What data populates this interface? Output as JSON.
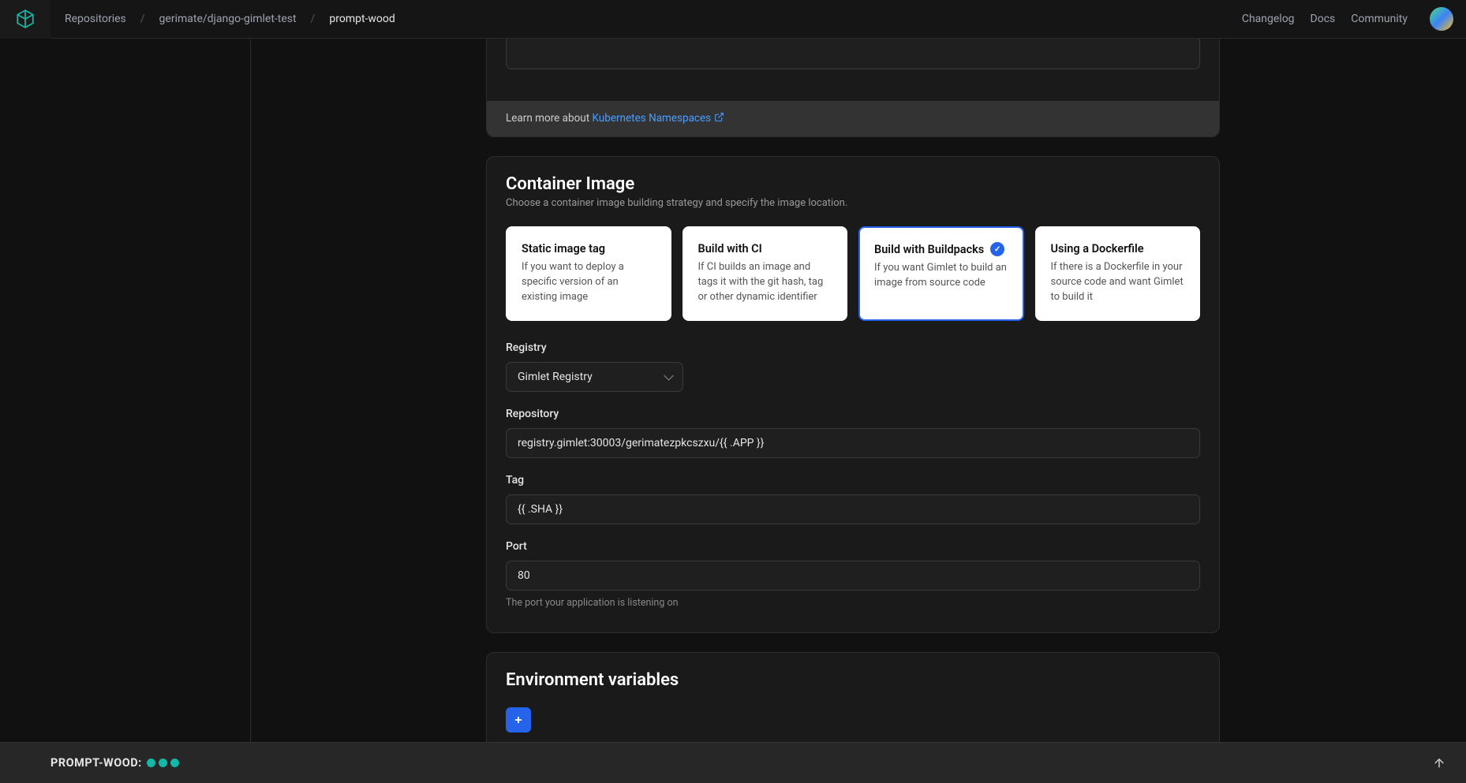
{
  "breadcrumb": {
    "root": "Repositories",
    "repo": "gerimate/django-gimlet-test",
    "current": "prompt-wood"
  },
  "topnav": {
    "changelog": "Changelog",
    "docs": "Docs",
    "community": "Community"
  },
  "notice": {
    "prefix": "Learn more about ",
    "link": "Kubernetes Namespaces"
  },
  "container": {
    "title": "Container Image",
    "subtitle": "Choose a container image building strategy and specify the image location.",
    "options": [
      {
        "title": "Static image tag",
        "desc": "If you want to deploy a specific version of an existing image"
      },
      {
        "title": "Build with CI",
        "desc": "If CI builds an image and tags it with the git hash, tag or other dynamic identifier"
      },
      {
        "title": "Build with Buildpacks",
        "desc": "If you want Gimlet to build an image from source code"
      },
      {
        "title": "Using a Dockerfile",
        "desc": "If there is a Dockerfile in your source code and want Gimlet to build it"
      }
    ],
    "registry_label": "Registry",
    "registry_value": "Gimlet Registry",
    "repository_label": "Repository",
    "repository_value": "registry.gimlet:30003/gerimatezpkcszxu/{{ .APP }}",
    "tag_label": "Tag",
    "tag_value": "{{ .SHA }}",
    "port_label": "Port",
    "port_value": "80",
    "port_helper": "The port your application is listening on"
  },
  "env": {
    "title": "Environment variables"
  },
  "footer": {
    "label": "PROMPT-WOOD:"
  }
}
